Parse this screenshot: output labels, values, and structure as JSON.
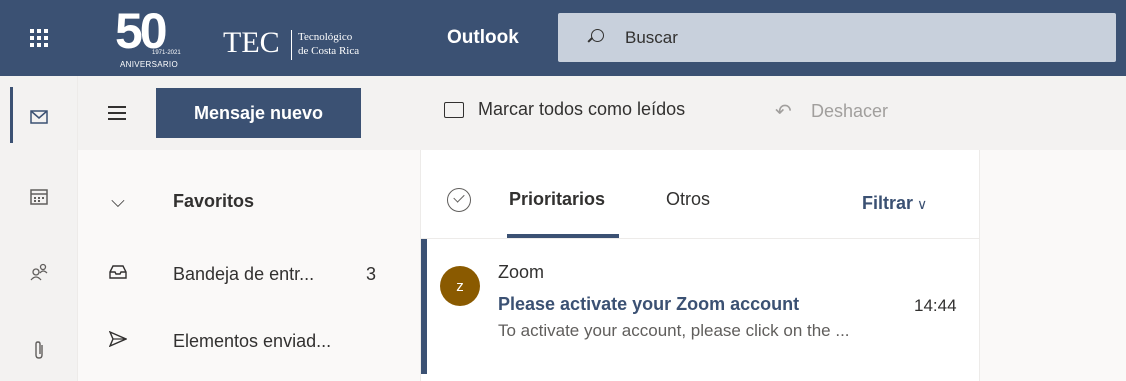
{
  "header": {
    "logo": {
      "big_number": "50",
      "years": "1971-2021",
      "anniversary": "ANIVERSARIO",
      "brand": "TEC",
      "subtitle_line1": "Tecnológico",
      "subtitle_line2": "de Costa Rica"
    },
    "app_name": "Outlook",
    "search": {
      "placeholder": "Buscar"
    }
  },
  "rail": {
    "items": [
      {
        "name": "mail",
        "icon": "mail-icon",
        "selected": true
      },
      {
        "name": "calendar",
        "icon": "calendar-icon"
      },
      {
        "name": "people",
        "icon": "people-icon"
      },
      {
        "name": "files",
        "icon": "paperclip-icon"
      }
    ]
  },
  "toolbar": {
    "new_message": "Mensaje nuevo",
    "mark_all_read": "Marcar todos como leídos",
    "undo": "Deshacer"
  },
  "folders": {
    "favorites_label": "Favoritos",
    "items": [
      {
        "label": "Bandeja de entr...",
        "count": "3",
        "icon": "inbox-icon"
      },
      {
        "label": "Elementos enviad...",
        "count": "",
        "icon": "send-icon"
      }
    ]
  },
  "message_list": {
    "tabs": [
      {
        "label": "Prioritarios",
        "active": true
      },
      {
        "label": "Otros",
        "active": false
      }
    ],
    "filter": "Filtrar",
    "messages": [
      {
        "avatar": "z",
        "sender": "Zoom",
        "subject": "Please activate your Zoom account",
        "time": "14:44",
        "preview": "To activate your account, please click on the ..."
      }
    ]
  },
  "colors": {
    "brand": "#3b5173",
    "avatar": "#8a5a00"
  }
}
